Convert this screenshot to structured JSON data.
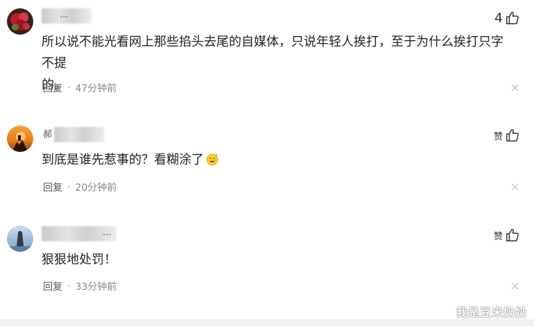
{
  "comments": [
    {
      "username_fragment": "...",
      "like_count": "4",
      "text_line1": "所以说不能光看网上那些掐头去尾的自媒体，只说年轻人挨打，至于为什么挨打只字不提",
      "text_line2": "的。",
      "reply_label": "回复",
      "separator": "·",
      "time": "47分钟前"
    },
    {
      "username_fragment": "郝",
      "like_label": "赞",
      "text": "到底是谁先惹事的？看糊涂了",
      "reply_label": "回复",
      "separator": "·",
      "time": "20分钟前"
    },
    {
      "username_fragment": "...",
      "like_label": "赞",
      "text": "狠狠地处罚！",
      "reply_label": "回复",
      "separator": "·",
      "time": "33分钟前"
    }
  ],
  "watermark": "我是豆米奶奶",
  "icons": {
    "like": "thumbs-up-icon",
    "close": "close-icon",
    "emoji": "sweat-smile-emoji"
  }
}
